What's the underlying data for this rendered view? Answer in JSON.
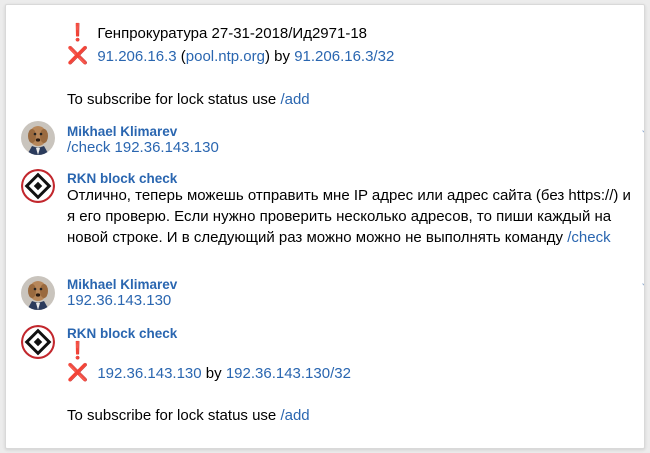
{
  "msg1": {
    "excl": "❗",
    "line1": "Генпрокуратура 27-31-2018/Ид2971-18",
    "cross": "❌",
    "ip": "91.206.16.3",
    "paren_open": " (",
    "host": "pool.ntp.org",
    "paren_close": ")",
    "by": " by ",
    "subnet": "91.206.16.3/32",
    "subscribe_text": "To subscribe for lock status use ",
    "subscribe_cmd": "/add"
  },
  "msg2": {
    "author": "Mikhael Klimarev",
    "cmd": "/check",
    "arg": " 192.36.143.130"
  },
  "msg3": {
    "author": "RKN block check",
    "text": "Отлично, теперь можешь отправить мне IP адрес или адрес сайта (без https://) и я его проверю. Если нужно проверить несколько адресов, то пиши каждый на новой строке. И в следующий раз можно можно не выполнять команду ",
    "cmd": "/check"
  },
  "msg4": {
    "author": "Mikhael Klimarev",
    "ip": "192.36.143.130"
  },
  "msg5": {
    "author": "RKN block check",
    "excl": "❗",
    "cross": "❌",
    "ip": "192.36.143.130",
    "by": " by ",
    "subnet": "192.36.143.130/32",
    "subscribe_text": "To subscribe for lock status use ",
    "subscribe_cmd": "/add"
  },
  "colors": {
    "link": "#2a66b0",
    "alert": "#d3202a"
  },
  "icons": {
    "user_avatar": "dog-avatar",
    "bot_avatar": "rkn-logo-avatar"
  }
}
